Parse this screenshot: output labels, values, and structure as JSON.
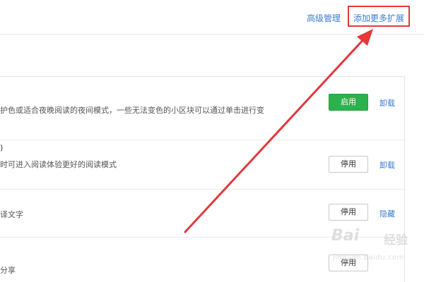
{
  "header": {
    "advanced_label": "高级管理",
    "add_more_label": "添加更多扩展"
  },
  "extensions": [
    {
      "title": "",
      "description": "护色或适合夜晚阅读的夜间模式，一些无法变色的小区块可以通过单击进行变",
      "button_label": "启用",
      "button_state": "enabled",
      "action_label": "卸载"
    },
    {
      "title": ")",
      "description": "时可进入阅读体验更好的阅读模式",
      "button_label": "停用",
      "button_state": "disabled",
      "action_label": "卸载"
    },
    {
      "title": "",
      "description": "译文字",
      "button_label": "停用",
      "button_state": "disabled",
      "action_label": "隐藏"
    },
    {
      "title": "",
      "description": "分享",
      "button_label": "停用",
      "button_state": "disabled",
      "action_label": ""
    }
  ],
  "colors": {
    "link": "#3b7bd6",
    "enable_green": "#2bb24c",
    "annotation_red": "#e5383b"
  },
  "watermark": {
    "brand": "Bai",
    "suffix": "经验",
    "url": "jingyan.baidu.com"
  }
}
